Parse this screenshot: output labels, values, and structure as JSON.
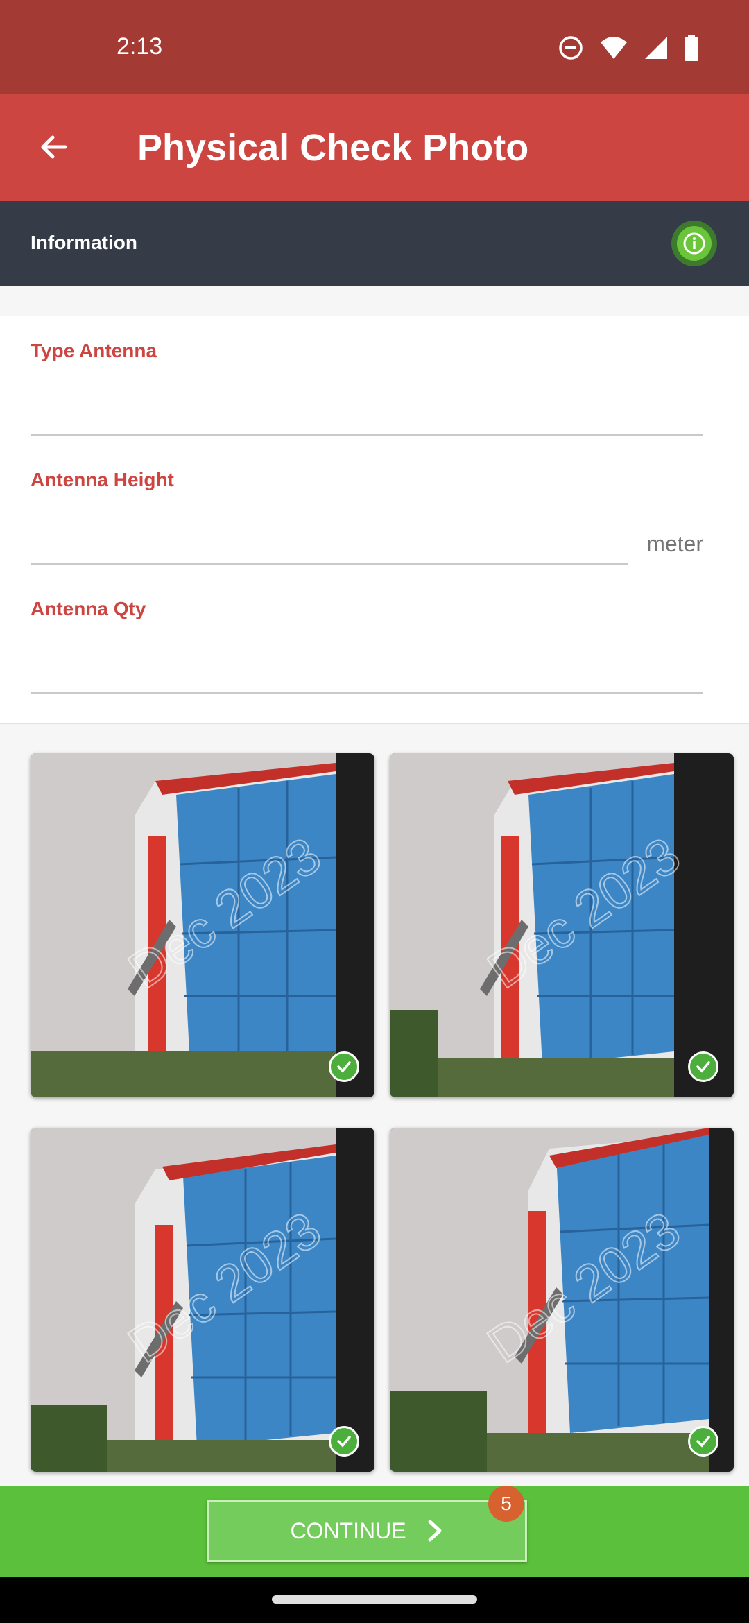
{
  "status_bar": {
    "time": "2:13"
  },
  "app_bar": {
    "title": "Physical Check Photo"
  },
  "info_bar": {
    "label": "Information"
  },
  "form": {
    "type_antenna": {
      "label": "Type Antenna",
      "value": ""
    },
    "antenna_height": {
      "label": "Antenna Height",
      "value": "",
      "unit": "meter"
    },
    "antenna_qty": {
      "label": "Antenna Qty",
      "value": ""
    }
  },
  "photos": [
    {
      "watermark": "Dec 2023",
      "checked": true
    },
    {
      "watermark": "Dec 2023",
      "checked": true
    },
    {
      "watermark": "Dec 2023",
      "checked": true
    },
    {
      "watermark": "Dec 2023",
      "checked": true
    }
  ],
  "footer": {
    "continue_label": "CONTINUE",
    "badge_count": "5"
  },
  "colors": {
    "status_bar": "#a33a34",
    "app_bar": "#cc4540",
    "info_bar": "#353b47",
    "accent_green": "#5bc03b",
    "badge": "#d7612f"
  }
}
